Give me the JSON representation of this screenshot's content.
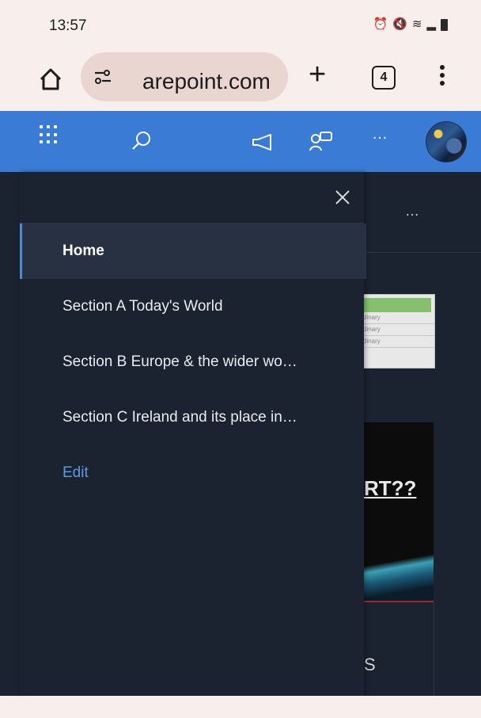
{
  "status_bar": {
    "time": "13:57",
    "icons": [
      "alarm-icon",
      "mute-icon",
      "wifi-icon",
      "signal-icon",
      "battery-icon"
    ]
  },
  "browser": {
    "url": "　arepoint.com",
    "tab_count": "4"
  },
  "suite_bar": {
    "color": "#3a7bd5",
    "more": "…"
  },
  "page": {
    "more": "…",
    "thumb_rows": [
      "dinary",
      "dinary",
      "dinary"
    ],
    "card_title": "RT??",
    "card_text": "S"
  },
  "drawer": {
    "items": [
      {
        "label": "Home",
        "active": true
      },
      {
        "label": "Section A Today's World"
      },
      {
        "label": "Section B Europe & the wider wo…"
      },
      {
        "label": "Section C Ireland and its place in…"
      }
    ],
    "edit_label": "Edit"
  }
}
